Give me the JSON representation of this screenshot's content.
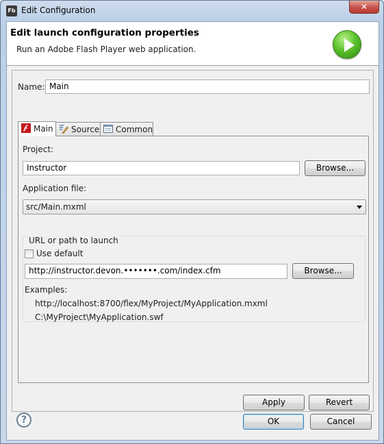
{
  "window": {
    "title": "Edit Configuration",
    "app_icon_text": "Fb",
    "close_glyph": "✕"
  },
  "header": {
    "title": "Edit launch configuration properties",
    "subtitle": "Run an Adobe Flash Player web application."
  },
  "form": {
    "name_label": "Name:",
    "name_value": "Main"
  },
  "tabs": [
    {
      "label": "Main",
      "icon": "flash-icon",
      "active": true
    },
    {
      "label": "Source",
      "icon": "source-icon",
      "active": false
    },
    {
      "label": "Common",
      "icon": "common-icon",
      "active": false
    }
  ],
  "main_tab": {
    "project_label": "Project:",
    "project_value": "Instructor",
    "project_browse": "Browse...",
    "app_file_label": "Application file:",
    "app_file_value": "src/Main.mxml",
    "url_group_title": "URL or path to launch",
    "use_default_label": "Use default",
    "use_default_checked": false,
    "url_value": "http://instructor.devon.•••••••.com/index.cfm",
    "url_browse": "Browse...",
    "examples_label": "Examples:",
    "example_1": "http://localhost:8700/flex/MyProject/MyApplication.mxml",
    "example_2": "C:\\MyProject\\MyApplication.swf"
  },
  "actions": {
    "apply": "Apply",
    "revert": "Revert"
  },
  "footer": {
    "ok": "OK",
    "cancel": "Cancel",
    "help_glyph": "?"
  },
  "colors": {
    "accent": "#3c7fb1",
    "run_icon": "#5cc22c",
    "close": "#c75050"
  }
}
